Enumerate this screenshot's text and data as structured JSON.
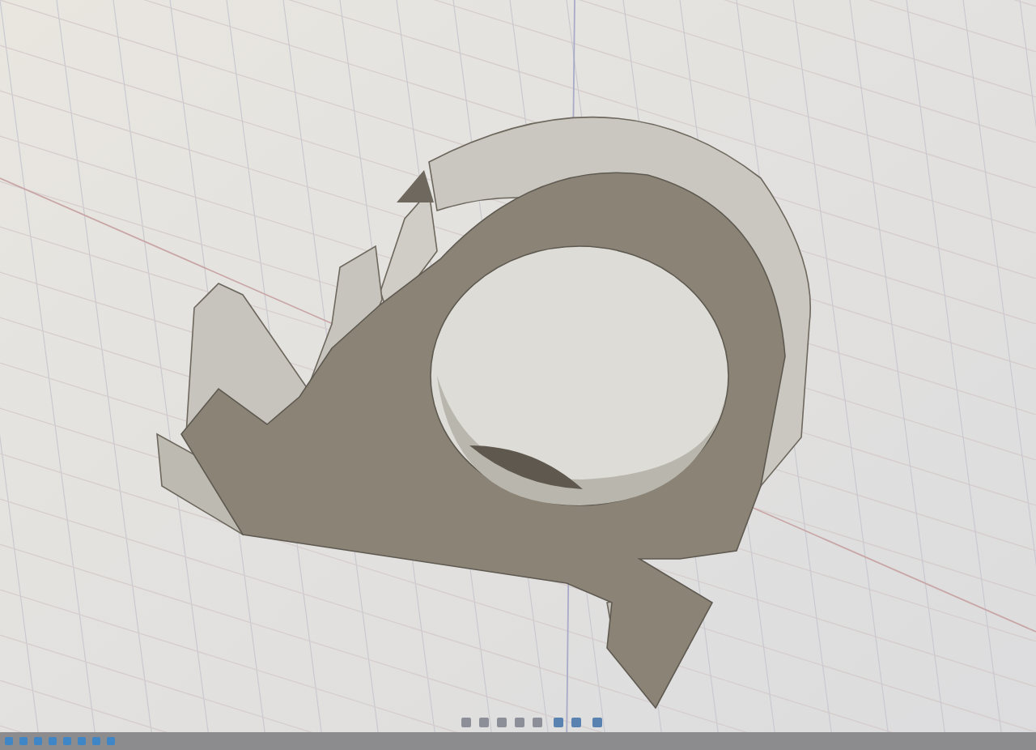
{
  "viewport": {
    "kind": "cad-part"
  }
}
